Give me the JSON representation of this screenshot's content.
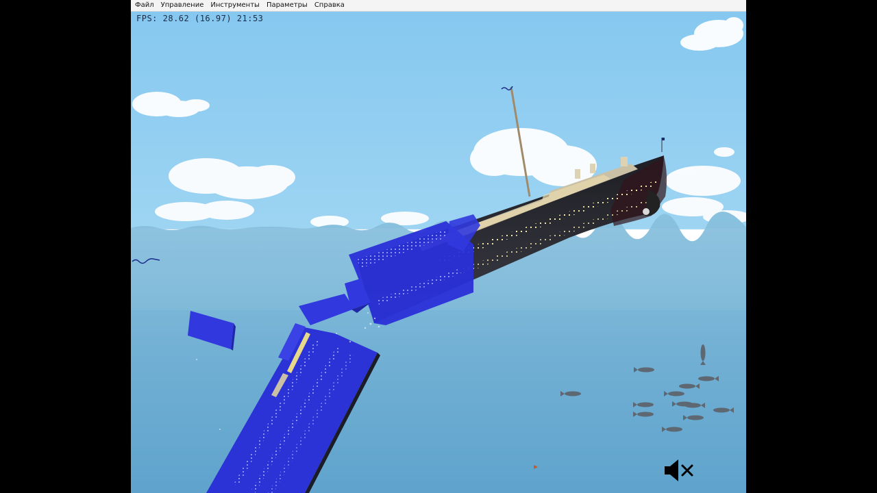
{
  "menu": {
    "items": [
      "Файл",
      "Управление",
      "Инструменты",
      "Параметры",
      "Справка"
    ]
  },
  "hud": {
    "fps_text": "FPS: 28.62 (16.97) 21:53"
  },
  "icons": {
    "sound": "speaker-muted-icon"
  },
  "colors": {
    "sky": "#8ccbef",
    "water": "#74b4d6",
    "hull": "#2b2b34",
    "flooded": "#2a35d6"
  }
}
